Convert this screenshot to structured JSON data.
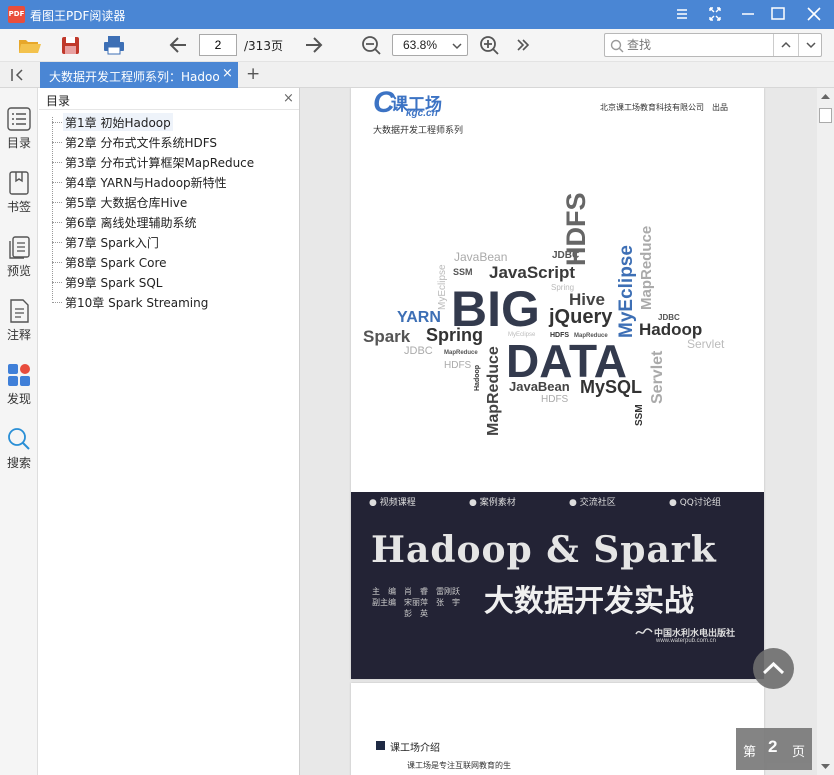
{
  "window": {
    "app_title": "看图王PDF阅读器",
    "icon_text": "PDF"
  },
  "toolbar": {
    "page_current": "2",
    "page_total": "/313页",
    "zoom": "63.8%",
    "search_placeholder": "查找"
  },
  "tab": {
    "label": "大数据开发工程师系列：Hadoop",
    "close": "×",
    "add": "+"
  },
  "sidebar": {
    "items": [
      {
        "label": "目录",
        "icon": "toc-icon"
      },
      {
        "label": "书签",
        "icon": "bookmark-icon"
      },
      {
        "label": "预览",
        "icon": "preview-icon"
      },
      {
        "label": "注释",
        "icon": "annotation-icon"
      },
      {
        "label": "发现",
        "icon": "discover-icon"
      },
      {
        "label": "搜索",
        "icon": "search-icon"
      }
    ]
  },
  "toc": {
    "title": "目录",
    "close": "×",
    "items": [
      "第1章 初始Hadoop",
      "第2章 分布式文件系统HDFS",
      "第3章 分布式计算框架MapReduce",
      "第4章 YARN与Hadoop新特性",
      "第5章 大数据仓库Hive",
      "第6章 离线处理辅助系统",
      "第7章 Spark入门",
      "第8章 Spark Core",
      "第9章 Spark SQL",
      "第10章 Spark Streaming"
    ]
  },
  "cover": {
    "logo": "课工场",
    "logo_sub": "kgc.cn",
    "series": "大数据开发工程师系列",
    "publisher": "北京课工场教育科技有限公司　出品",
    "cloud": {
      "big": "BIG",
      "data": "DATA",
      "javascript": "JavaScript",
      "javabean1": "JavaBean",
      "jdbc1": "JDBC",
      "hdfs1": "HDFS",
      "hive": "Hive",
      "jquery": "jQuery",
      "myeclipse1": "MyEclipse",
      "mapreduce1": "MapReduce",
      "hadoop": "Hadoop",
      "jdbc2": "JDBC",
      "servlet1": "Servlet",
      "yarn": "YARN",
      "spring1": "Spring",
      "spark": "Spark",
      "ssm1": "SSM",
      "myeclipse2": "MyEclipse",
      "jdbc3": "JDBC",
      "mapreduce2": "MapReduce",
      "hdfs2": "HDFS",
      "hadoop2": "Hadoop",
      "mapreduce3": "MapReduce",
      "javabean2": "JavaBean",
      "mysql": "MySQL",
      "servlet2": "Servlet",
      "ssm2": "SSM",
      "hdfs3": "HDFS",
      "spring2": "Spring",
      "myeclipse3": "MyEclipse",
      "hdfs4": "HDFS",
      "mapreduce4": "MapReduce"
    },
    "tags": [
      "● 视频课程",
      "● 案例素材",
      "● 交流社区",
      "● QQ讨论组"
    ],
    "title_en": "Hadoop & Spark",
    "title_cn": "大数据开发实战",
    "authors": [
      "主　编　肖　睿　雷刚跃",
      "副主编　宋丽萍　张　宇",
      "　　　　彭　英"
    ],
    "press": "中国水利水电出版社",
    "press_url": "www.waterpub.com.cn"
  },
  "page2": {
    "heading": "课工场介绍",
    "line1": "课工场是专注互联网教育的生"
  },
  "badge": {
    "prefix": "第",
    "num": "2",
    "suffix": "页"
  }
}
